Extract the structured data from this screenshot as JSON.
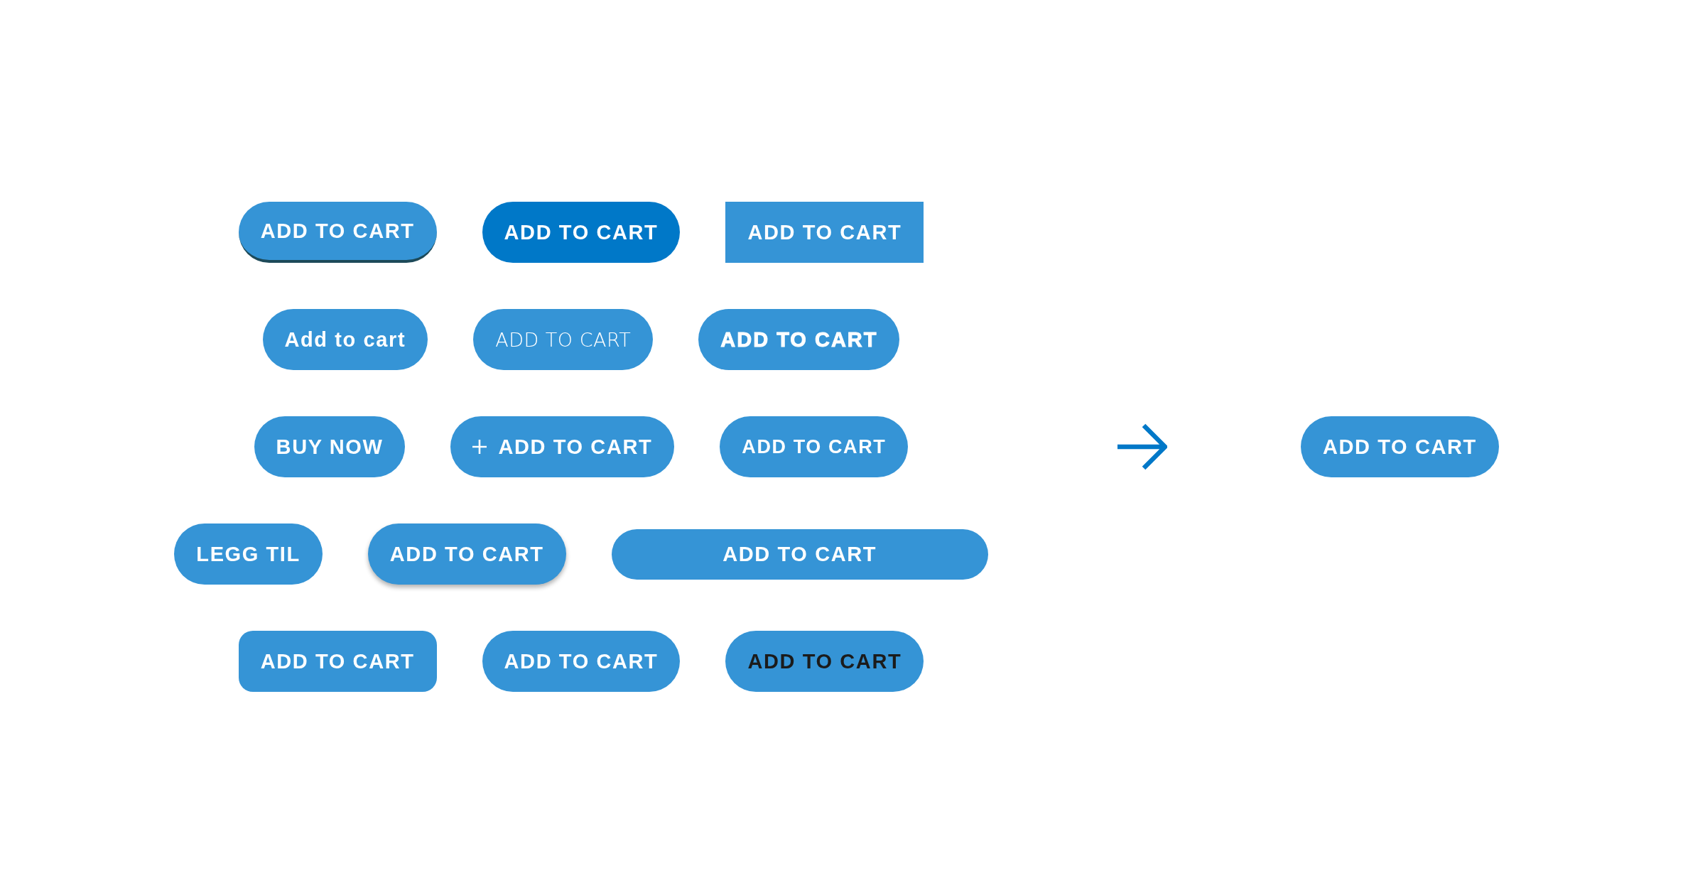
{
  "rows": [
    {
      "buttons": [
        {
          "label": "ADD TO CART",
          "kind": "raised"
        },
        {
          "label": "ADD TO CART",
          "kind": "dark"
        },
        {
          "label": "ADD TO CART",
          "kind": "square"
        }
      ]
    },
    {
      "buttons": [
        {
          "label": "Add to cart",
          "kind": "pill"
        },
        {
          "label": "ADD TO CART",
          "kind": "light"
        },
        {
          "label": "ADD TO CART",
          "kind": "bold"
        }
      ]
    },
    {
      "buttons": [
        {
          "label": "BUY NOW",
          "kind": "pill"
        },
        {
          "label": "ADD TO CART",
          "kind": "icon"
        },
        {
          "label": "ADD TO CART",
          "kind": "small"
        }
      ]
    },
    {
      "buttons": [
        {
          "label": "LEGG TIL",
          "kind": "pill"
        },
        {
          "label": "ADD TO CART",
          "kind": "shadow"
        },
        {
          "label": "ADD TO CART",
          "kind": "wide"
        }
      ]
    },
    {
      "buttons": [
        {
          "label": "ADD TO CART",
          "kind": "rounded"
        },
        {
          "label": "ADD TO CART",
          "kind": "pill"
        },
        {
          "label": "ADD TO CART",
          "kind": "dark-text"
        }
      ]
    }
  ],
  "result_button": {
    "label": "ADD TO CART"
  }
}
